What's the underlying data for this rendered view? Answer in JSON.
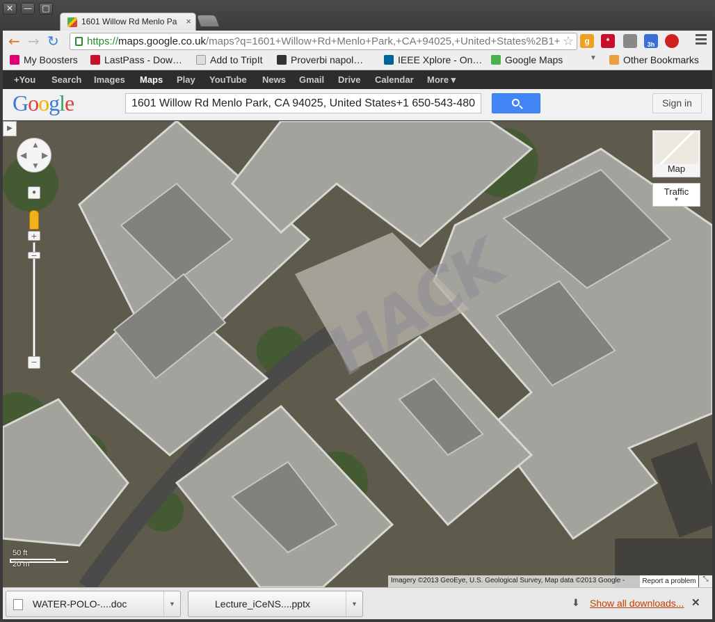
{
  "tab": {
    "title": "1601 Willow Rd Menlo Pa",
    "close_glyph": "×"
  },
  "window_buttons": {
    "close": "✕",
    "minimize": "—",
    "maximize": "□"
  },
  "nav": {
    "back": "←",
    "forward": "→",
    "reload": "↻"
  },
  "omnibox": {
    "scheme": "https://",
    "host": "maps.google.co.uk",
    "path": "/maps?q=1601+Willow+Rd+Menlo+Park,+CA+94025,+United+States%2B1+"
  },
  "extensions": [
    {
      "name": "goodreads-icon",
      "label": "g",
      "color": "#f0a020"
    },
    {
      "name": "lastpass-icon",
      "label": "*",
      "color": "#c8102e"
    },
    {
      "name": "print-icon",
      "label": "",
      "color": "#888888"
    },
    {
      "name": "calendar-icon",
      "label": "3h",
      "color": "#3a6fd8"
    },
    {
      "name": "stop-icon",
      "label": "",
      "color": "#d02020"
    }
  ],
  "bookmarks": [
    {
      "label": "My Boosters",
      "color": "#e20074"
    },
    {
      "label": "LastPass - Dow…",
      "color": "#c8102e"
    },
    {
      "label": "Add to TripIt",
      "color": "#dddddd"
    },
    {
      "label": "Proverbi napol…",
      "color": "#333333"
    },
    {
      "label": "IEEE Xplore - On…",
      "color": "#00629b"
    },
    {
      "label": "Google Maps",
      "color": "#4caf50"
    }
  ],
  "bookmarks_more": "Other Bookmarks",
  "gbar": [
    "+You",
    "Search",
    "Images",
    "Maps",
    "Play",
    "YouTube",
    "News",
    "Gmail",
    "Drive",
    "Calendar",
    "More ▾"
  ],
  "gbar_active": "Maps",
  "logo": [
    "G",
    "o",
    "o",
    "g",
    "l",
    "e"
  ],
  "search": {
    "value": "1601 Willow Rd Menlo Park, CA 94025, United States+1 650-543-480",
    "signin": "Sign in"
  },
  "map": {
    "controls": {
      "map_label": "Map",
      "traffic_label": "Traffic",
      "zoom_in": "+",
      "zoom_out": "−",
      "panel_toggle": "▶"
    },
    "scale": {
      "imperial": "50 ft",
      "metric": "20 m"
    },
    "attribution": "Imagery ©2013 GeoEye, U.S. Geological Survey, Map data ©2013 Google -",
    "report": "Report a problem",
    "plaza_text": "HACK"
  },
  "downloads": {
    "items": [
      {
        "filename": "WATER-POLO-....doc"
      },
      {
        "filename": "Lecture_iCeNS....pptx"
      }
    ],
    "show_all": "Show all downloads...",
    "close": "✕"
  }
}
